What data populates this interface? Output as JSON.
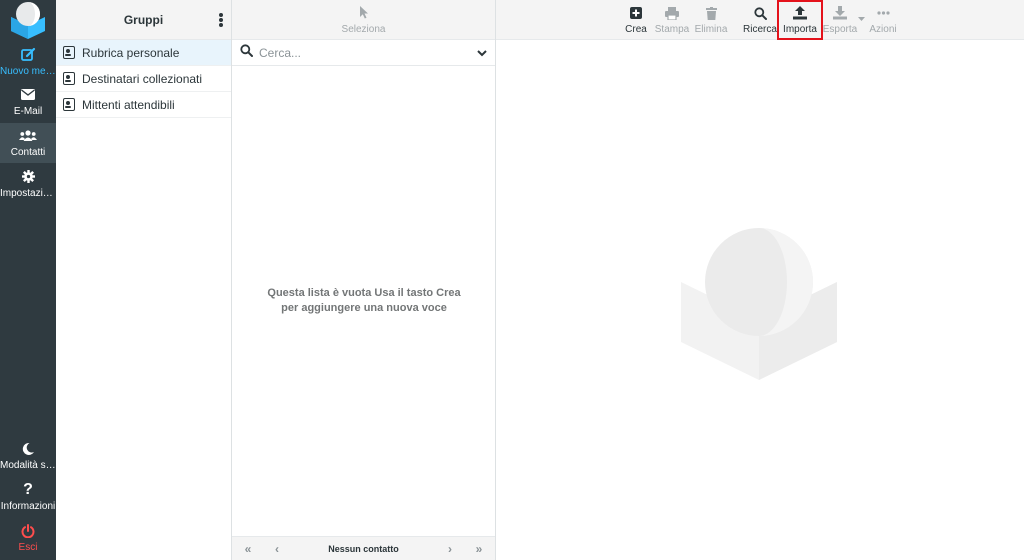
{
  "nav": {
    "compose_label": "Nuovo mes...",
    "mail_label": "E-Mail",
    "contacts_label": "Contatti",
    "settings_label": "Impostazioni",
    "darkmode_label": "Modalità sc...",
    "about_label": "Informazioni",
    "logout_label": "Esci"
  },
  "groups": {
    "header": "Gruppi",
    "items": [
      {
        "label": "Rubrica personale",
        "selected": true
      },
      {
        "label": "Destinatari collezionati",
        "selected": false
      },
      {
        "label": "Mittenti attendibili",
        "selected": false
      }
    ]
  },
  "list": {
    "select_label": "Seleziona",
    "search_placeholder": "Cerca...",
    "empty_message": "Questa lista è vuota Usa il tasto Crea per aggiungere una nuova voce",
    "pager_count": "Nessun contatto"
  },
  "toolbar": {
    "create_label": "Crea",
    "print_label": "Stampa",
    "delete_label": "Elimina",
    "search_label": "Ricerca",
    "import_label": "Importa",
    "export_label": "Esporta",
    "actions_label": "Azioni"
  },
  "colors": {
    "nav_bg": "#2f3a40",
    "accent": "#37beff",
    "logout": "#ff4d4d",
    "highlight_border": "#e4121b"
  }
}
